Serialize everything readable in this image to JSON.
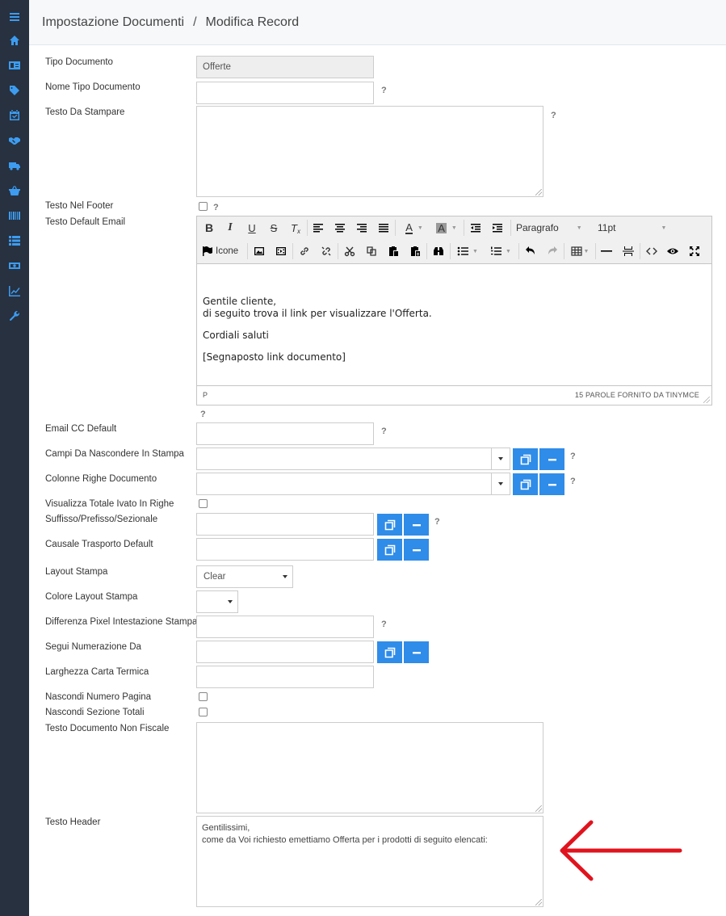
{
  "breadcrumb": {
    "section": "Impostazione Documenti",
    "separator": "/",
    "current": "Modifica Record"
  },
  "sidebar": {
    "icons": [
      "menu-icon",
      "home-icon",
      "contact-card-icon",
      "tags-icon",
      "calendar-check-icon",
      "handshake-icon",
      "truck-icon",
      "basket-icon",
      "barcode-icon",
      "list-icon",
      "money-icon",
      "chart-line-icon",
      "wrench-icon"
    ]
  },
  "help_mark": "?",
  "fields": {
    "tipo_documento": {
      "label": "Tipo Documento",
      "value": "Offerte"
    },
    "nome_tipo_documento": {
      "label": "Nome Tipo Documento",
      "value": ""
    },
    "testo_da_stampare": {
      "label": "Testo Da Stampare",
      "value": ""
    },
    "testo_nel_footer": {
      "label": "Testo Nel Footer",
      "checked": false
    },
    "testo_default_email": {
      "label": "Testo Default Email"
    },
    "email_cc_default": {
      "label": "Email CC Default",
      "value": ""
    },
    "campi_da_nascondere": {
      "label": "Campi Da Nascondere In Stampa",
      "value": ""
    },
    "colonne_righe_documento": {
      "label": "Colonne Righe Documento",
      "value": ""
    },
    "visualizza_totale_ivato": {
      "label": "Visualizza Totale Ivato In Righe",
      "checked": false
    },
    "suffisso_prefisso": {
      "label": "Suffisso/Prefisso/Sezionale",
      "value": ""
    },
    "causale_trasporto": {
      "label": "Causale Trasporto Default",
      "value": ""
    },
    "layout_stampa": {
      "label": "Layout Stampa",
      "value": "Clear"
    },
    "colore_layout_stampa": {
      "label": "Colore Layout Stampa",
      "value": ""
    },
    "differenza_pixel": {
      "label": "Differenza Pixel Intestazione Stampa",
      "value": ""
    },
    "segui_numerazione": {
      "label": "Segui Numerazione Da",
      "value": ""
    },
    "larghezza_carta": {
      "label": "Larghezza Carta Termica",
      "value": ""
    },
    "nascondi_numero_pagina": {
      "label": "Nascondi Numero Pagina",
      "checked": false
    },
    "nascondi_sezione_totali": {
      "label": "Nascondi Sezione Totali",
      "checked": false
    },
    "testo_non_fiscale": {
      "label": "Testo Documento Non Fiscale",
      "value": ""
    },
    "testo_header": {
      "label": "Testo Header",
      "line1": "Gentilissimi,",
      "line2": "come da Voi richiesto emettiamo Offerta per i prodotti di seguito elencati:"
    }
  },
  "editor": {
    "icon_label": "Icone",
    "block_format": "Paragrafo",
    "font_size": "11pt",
    "content": {
      "line1": "Gentile cliente,",
      "line2": "di seguito trova il link per visualizzare l'Offerta.",
      "line3": "Cordiali saluti",
      "line4": "[Segnaposto link documento]"
    },
    "status_path": "P",
    "status_wordcount": "15 PAROLE FORNITO DA TINYMCE"
  },
  "colors": {
    "sidebar_bg": "#273140",
    "accent": "#2f8ce8",
    "arrow": "#e0141e"
  }
}
